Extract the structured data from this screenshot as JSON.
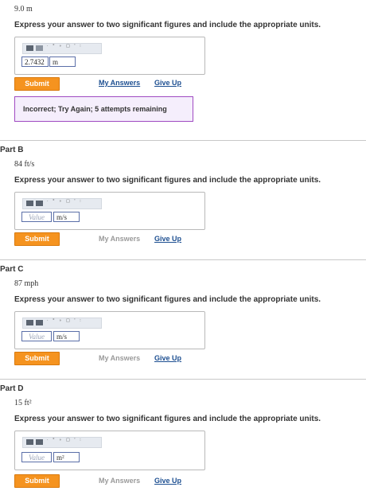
{
  "part_a": {
    "quantity": "9.0 m",
    "instruction": "Express your answer to two significant figures and include the appropriate units.",
    "value": "2.7432",
    "unit": "m",
    "submit_label": "Submit",
    "my_answers_label": "My Answers",
    "give_up_label": "Give Up",
    "feedback": "Incorrect; Try Again; 5 attempts remaining"
  },
  "part_b": {
    "title": "Part B",
    "quantity": "84 ft/s",
    "instruction": "Express your answer to two significant figures and include the appropriate units.",
    "value_placeholder": "Value",
    "unit": "m/s",
    "submit_label": "Submit",
    "my_answers_label": "My Answers",
    "give_up_label": "Give Up"
  },
  "part_c": {
    "title": "Part C",
    "quantity": "87 mph",
    "instruction": "Express your answer to two significant figures and include the appropriate units.",
    "value_placeholder": "Value",
    "unit": "m/s",
    "submit_label": "Submit",
    "my_answers_label": "My Answers",
    "give_up_label": "Give Up"
  },
  "part_d": {
    "title": "Part D",
    "quantity": "15 ft²",
    "instruction": "Express your answer to two significant figures and include the appropriate units.",
    "value_placeholder": "Value",
    "unit": "m²",
    "submit_label": "Submit",
    "my_answers_label": "My Answers",
    "give_up_label": "Give Up"
  },
  "toolbar_symbols": "· ° ∘ □ ' ∶",
  "colors": {
    "submit": "#f5931f",
    "link": "#1d4f91",
    "feedback_border": "#a04bc2",
    "field_border": "#5b6fa8"
  }
}
